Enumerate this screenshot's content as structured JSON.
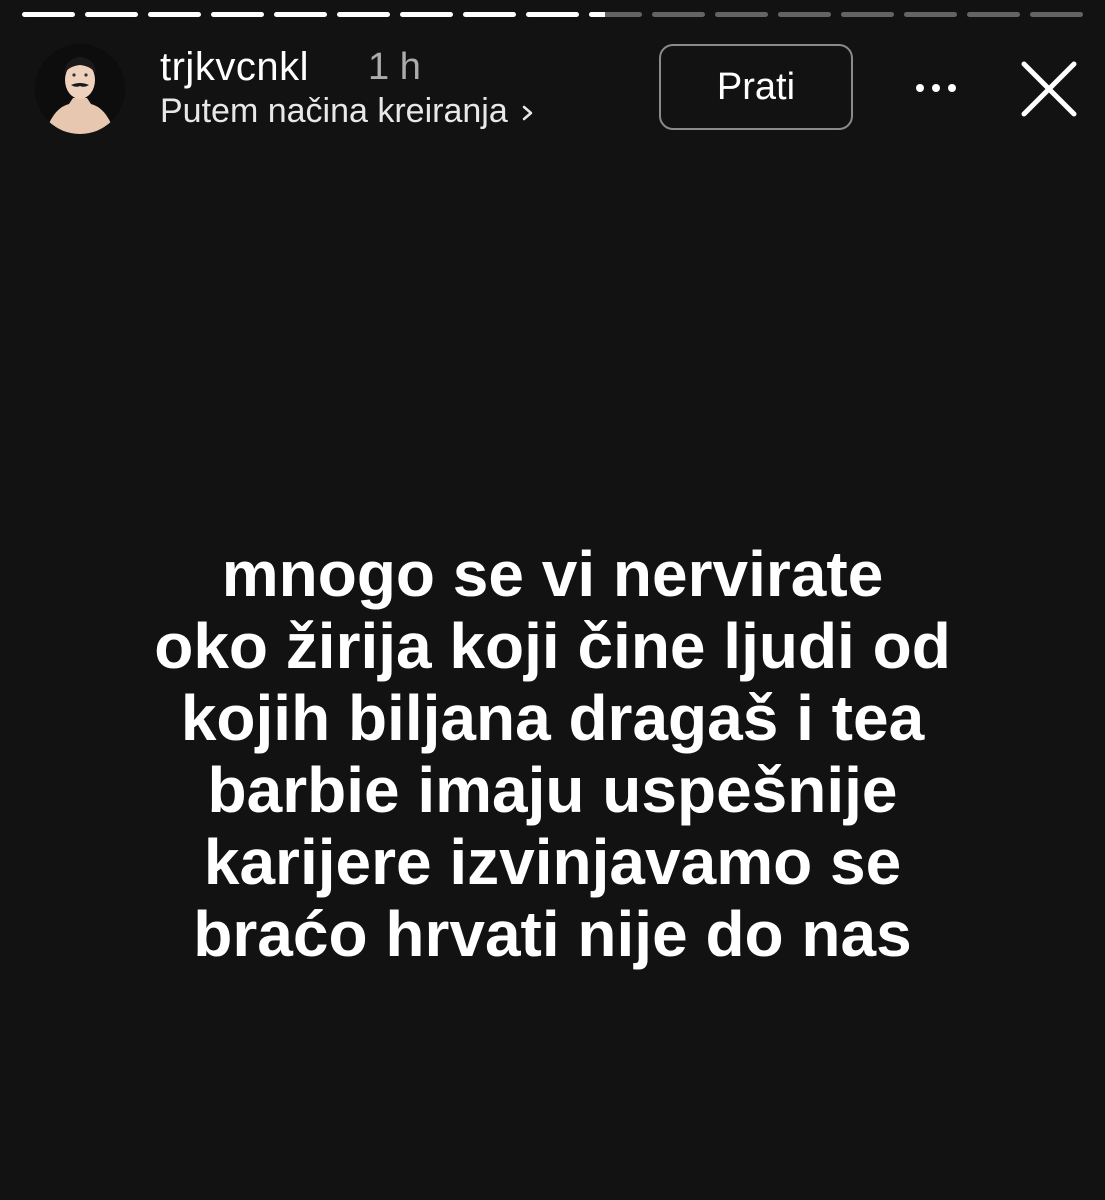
{
  "progress": {
    "segments": [
      {
        "fill": 1
      },
      {
        "fill": 1
      },
      {
        "fill": 1
      },
      {
        "fill": 1
      },
      {
        "fill": 1
      },
      {
        "fill": 1
      },
      {
        "fill": 1
      },
      {
        "fill": 1
      },
      {
        "fill": 1
      },
      {
        "fill": 0.3
      },
      {
        "fill": 0
      },
      {
        "fill": 0
      },
      {
        "fill": 0
      },
      {
        "fill": 0
      },
      {
        "fill": 0
      },
      {
        "fill": 0
      },
      {
        "fill": 0
      }
    ]
  },
  "header": {
    "username": "trjkvcnkl",
    "time": "1 h",
    "subline": "Putem načina kreiranja",
    "follow_label": "Prati",
    "more_icon": "more-horizontal-icon",
    "close_icon": "close-icon",
    "avatar_icon": "avatar-illustration"
  },
  "story": {
    "lines": [
      "mnogo se vi nervirate",
      "oko žirija koji čine ljudi od",
      "kojih biljana dragaš i tea",
      "barbie imaju uspešnije",
      "karijere izvinjavamo se",
      "braćo hrvati nije do nas"
    ]
  },
  "colors": {
    "background": "#121212",
    "text": "#ffffff",
    "progress_track": "rgba(255,255,255,0.35)",
    "progress_fill": "#ffffff",
    "button_border": "#8a8a8a"
  }
}
